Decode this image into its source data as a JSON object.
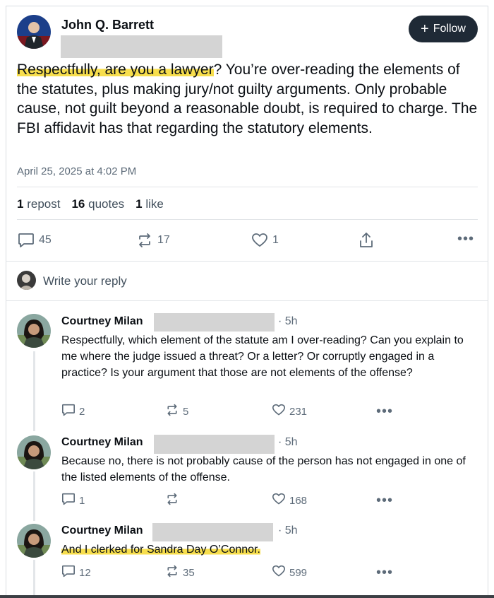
{
  "post": {
    "author": "John Q. Barrett",
    "follow_label": "Follow",
    "text_highlight": "Respectfully, are you a lawyer",
    "text_rest": "? You’re over-reading the elements of the statutes, plus making jury/not guilty arguments. Only probable cause, not guilt beyond a reasonable doubt, is required to charge. The FBI affidavit has that regarding the statutory elements.",
    "timestamp": "April 25, 2025 at 4:02 PM",
    "stats": {
      "reposts_count": "1",
      "reposts_label": "repost",
      "quotes_count": "16",
      "quotes_label": "quotes",
      "likes_count": "1",
      "likes_label": "like"
    },
    "actions": {
      "replies": "45",
      "reposts": "17",
      "likes": "1"
    }
  },
  "reply_box": {
    "placeholder": "Write your reply"
  },
  "comments": [
    {
      "name": "Courtney Milan",
      "time": "· 5h",
      "text": "Respectfully, which element of the statute am I over-reading? Can you explain to me where the judge issued a threat? Or a letter? Or corruptly engaged in a practice? Is your argument that those are not elements of the offense?",
      "replies": "2",
      "reposts": "5",
      "likes": "231"
    },
    {
      "name": "Courtney Milan",
      "time": "· 5h",
      "text": "Because no, there is not probably cause of the person has not engaged in one of the listed elements of the offense.",
      "replies": "1",
      "reposts": "",
      "likes": "168"
    },
    {
      "name": "Courtney Milan",
      "time": "· 5h",
      "text": "And I clerked for Sandra Day O’Connor.",
      "replies": "12",
      "reposts": "35",
      "likes": "599"
    }
  ],
  "colors": {
    "highlight": "#f7de4d",
    "follow_bg": "#1f2a36",
    "muted": "#5d6b79"
  }
}
